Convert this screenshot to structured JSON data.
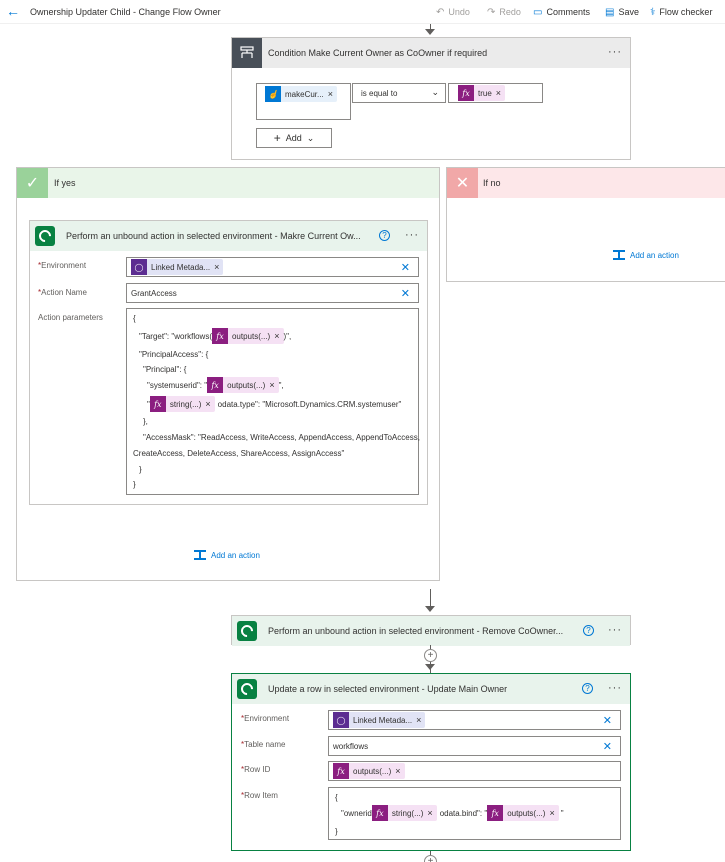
{
  "topbar": {
    "title": "Ownership Updater Child - Change Flow Owner",
    "undo": "Undo",
    "redo": "Redo",
    "comments": "Comments",
    "save": "Save",
    "flow_checker": "Flow checker"
  },
  "condition": {
    "title": "Condition Make Current Owner as CoOwner if required",
    "left_token": "makeCur...",
    "operator": "is equal to",
    "right_token": "true",
    "add_label": "Add"
  },
  "if_yes": {
    "label": "If yes",
    "add_action": "Add an action",
    "action": {
      "title": "Perform an unbound action in selected environment - Makre Current Ow...",
      "environment_label": "Environment",
      "environment_token": "Linked Metada...",
      "action_name_label": "Action Name",
      "action_name_value": "GrantAccess",
      "params_label": "Action parameters",
      "code": {
        "l1": "{",
        "l2a": "\"Target\": \"workflows(",
        "l2_token": "outputs(...)",
        "l2b": ")\",",
        "l3": "\"PrincipalAccess\": {",
        "l4": "\"Principal\": {",
        "l5a": "\"systemuserid\": \"",
        "l5_token": "outputs(...)",
        "l5b": "\",",
        "l6a": "\"",
        "l6_token": "string(...)",
        "l6b": "odata.type\": \"Microsoft.Dynamics.CRM.systemuser\"",
        "l7": "},",
        "l8": "\"AccessMask\": \"ReadAccess, WriteAccess, AppendAccess, AppendToAccess,",
        "l9": "CreateAccess, DeleteAccess, ShareAccess, AssignAccess\"",
        "l10": "}",
        "l11": "}"
      }
    }
  },
  "if_no": {
    "label": "If no",
    "add_action": "Add an action"
  },
  "remove_coowner": {
    "title": "Perform an unbound action in selected environment - Remove CoOwner..."
  },
  "update_row": {
    "title": "Update a row in selected environment - Update Main Owner",
    "environment_label": "Environment",
    "environment_token": "Linked Metada...",
    "table_label": "Table name",
    "table_value": "workflows",
    "row_id_label": "Row ID",
    "row_id_token": "outputs(...)",
    "row_item_label": "Row Item",
    "code": {
      "l1": "{",
      "l2a": "\"ownerid",
      "l2_token1": "string(...)",
      "l2b": "odata.bind\": \"",
      "l2_token2": "outputs(...)",
      "l2c": "\"",
      "l3": "}"
    }
  },
  "colors": {
    "accent": "#0078d4",
    "dataverse_green": "#088142",
    "fx_purple": "#8b1e80",
    "yes_green": "#e9f5e9",
    "no_red": "#fde7e9"
  }
}
